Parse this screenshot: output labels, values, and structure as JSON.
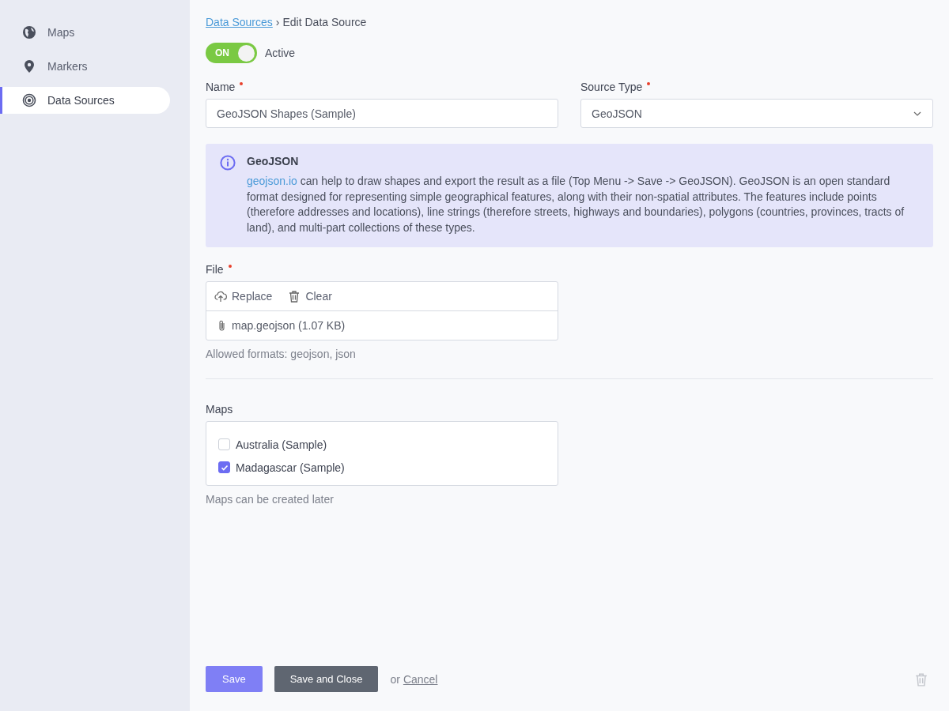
{
  "sidebar": {
    "items": [
      {
        "label": "Maps",
        "selected": false
      },
      {
        "label": "Markers",
        "selected": false
      },
      {
        "label": "Data Sources",
        "selected": true
      }
    ]
  },
  "breadcrumb": {
    "link": "Data Sources",
    "separator": "›",
    "current": "Edit Data Source"
  },
  "active_toggle": {
    "on": true,
    "state_text": "ON",
    "label": "Active"
  },
  "fields": [
    {
      "label": "Name",
      "required": true,
      "kind": "text",
      "value": "GeoJSON Shapes (Sample)"
    },
    {
      "label": "Source Type",
      "required": true,
      "kind": "select",
      "value": "GeoJSON"
    }
  ],
  "info": {
    "title": "GeoJSON",
    "link": "geojson.io",
    "text": " can help to draw shapes and export the result as a file (Top Menu -> Save -> GeoJSON). GeoJSON is an open standard format designed for representing simple geographical features, along with their non-spatial attributes. The features include points (therefore addresses and locations), line strings (therefore streets, highways and boundaries), polygons (countries, provinces, tracts of land), and multi-part collections of these types."
  },
  "file": {
    "label": "File",
    "required": true,
    "actions": [
      "Replace",
      "Clear"
    ],
    "filename": "map.geojson (1.07 KB)",
    "hint": "Allowed formats: geojson, json"
  },
  "maps": {
    "label": "Maps",
    "options": [
      {
        "label": "Australia (Sample)",
        "checked": false
      },
      {
        "label": "Madagascar (Sample)",
        "checked": true
      }
    ],
    "hint": "Maps can be created later"
  },
  "footer": {
    "save": "Save",
    "save_close": "Save and Close",
    "or": "or",
    "cancel": "Cancel"
  }
}
